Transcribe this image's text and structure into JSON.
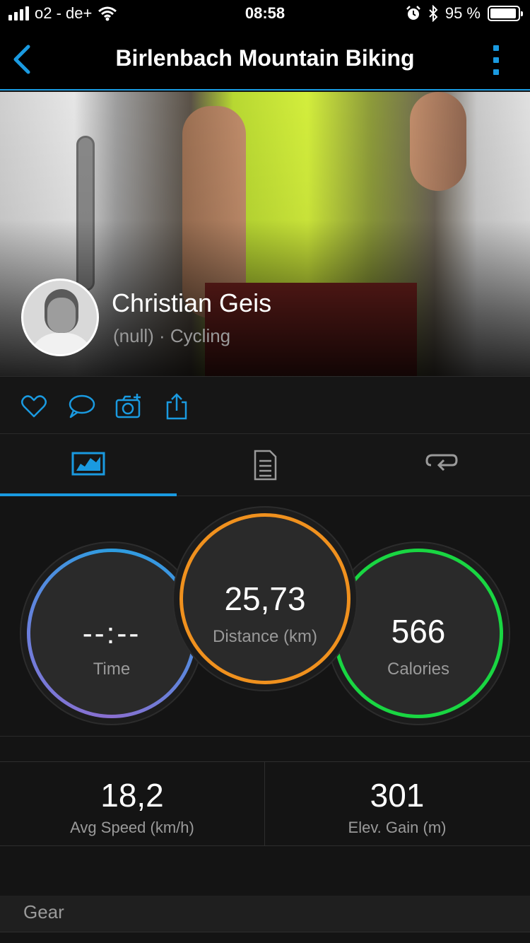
{
  "status_bar": {
    "carrier": "o2 - de+",
    "time": "08:58",
    "battery_text": "95 %",
    "battery_level": 0.95,
    "icons": [
      "signal-icon",
      "wifi-icon",
      "alarm-icon",
      "bluetooth-icon",
      "battery-icon"
    ]
  },
  "nav": {
    "title": "Birlenbach Mountain Biking",
    "back_icon": "chevron-left-icon",
    "more_icon": "more-vertical-icon"
  },
  "profile": {
    "name": "Christian Geis",
    "subtitle": "(null) · Cycling"
  },
  "actions": [
    {
      "icon": "heart-icon"
    },
    {
      "icon": "comment-icon"
    },
    {
      "icon": "add-photo-icon"
    },
    {
      "icon": "share-icon"
    }
  ],
  "tabs": [
    {
      "icon": "stats-chart-icon",
      "selected": true
    },
    {
      "icon": "details-list-icon",
      "selected": false
    },
    {
      "icon": "laps-repeat-icon",
      "selected": false
    }
  ],
  "circles": {
    "time": {
      "value": "--:--",
      "label": "Time"
    },
    "distance": {
      "value": "25,73",
      "label": "Distance (km)"
    },
    "calories": {
      "value": "566",
      "label": "Calories"
    }
  },
  "metrics": {
    "avg_speed": {
      "value": "18,2",
      "label": "Avg Speed (km/h)"
    },
    "elev_gain": {
      "value": "301",
      "label": "Elev. Gain (m)"
    }
  },
  "gear": {
    "label": "Gear"
  },
  "colors": {
    "accent": "#1a9ae0",
    "distance_ring": "#f0911e",
    "calories_ring": "#19d642",
    "time_ring_start": "#2d9de0",
    "time_ring_end": "#8a6fd0"
  }
}
